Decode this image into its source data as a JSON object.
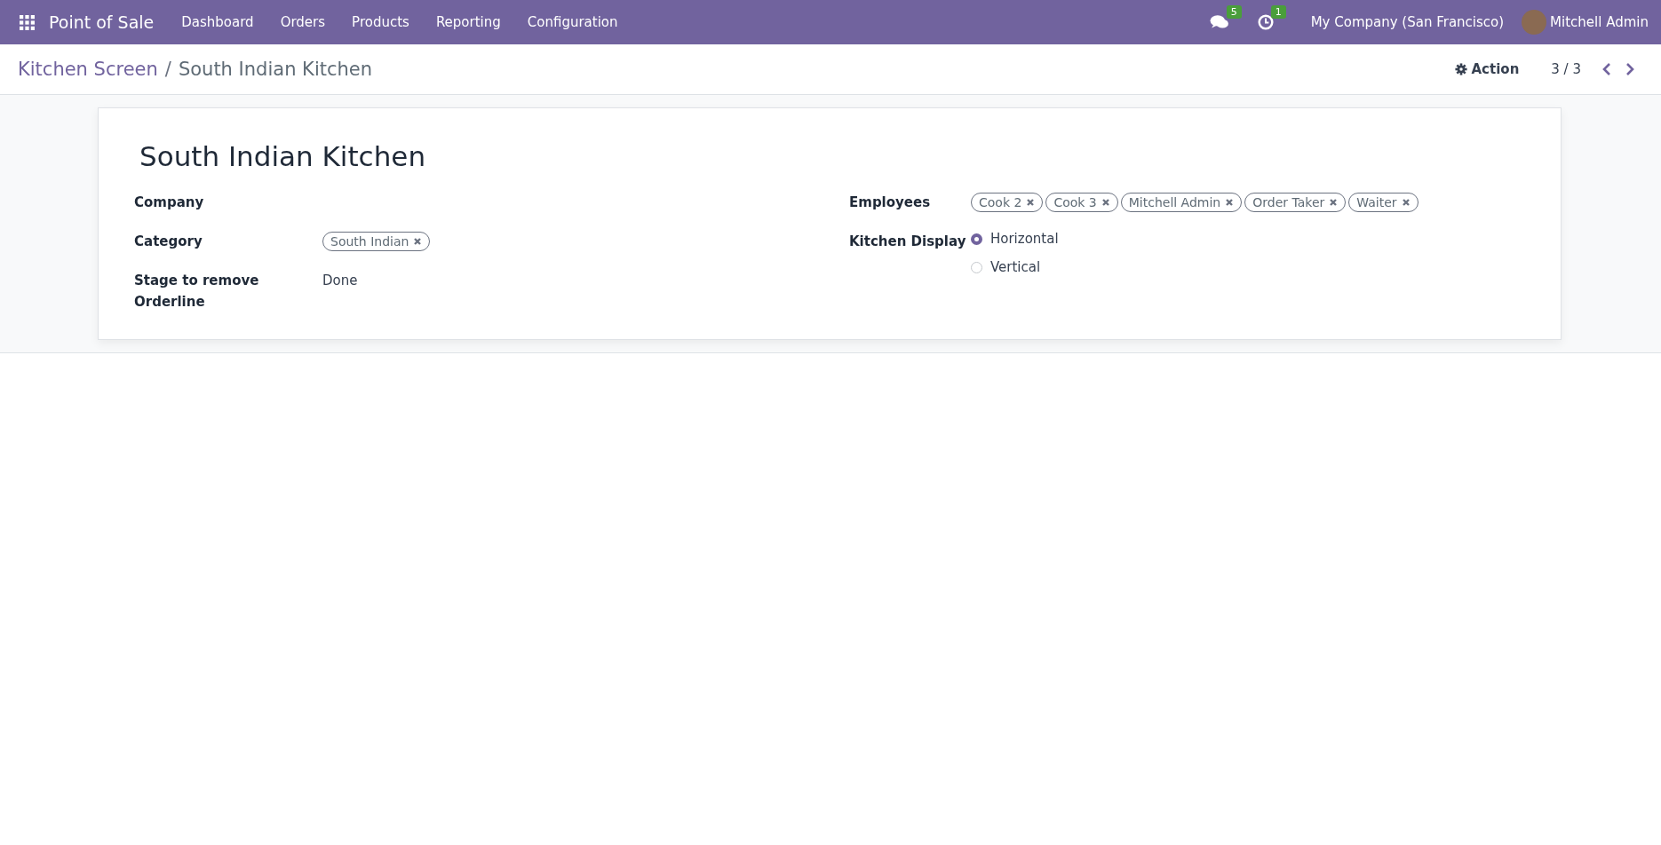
{
  "navbar": {
    "app_name": "Point of Sale",
    "menu": [
      "Dashboard",
      "Orders",
      "Products",
      "Reporting",
      "Configuration"
    ],
    "messages_count": "5",
    "activities_count": "1",
    "company": "My Company (San Francisco)",
    "user": "Mitchell Admin"
  },
  "breadcrumb": {
    "parent": "Kitchen Screen",
    "separator": "/",
    "current": "South Indian Kitchen"
  },
  "control_panel": {
    "action": "Action",
    "pager": "3 / 3"
  },
  "form": {
    "title": "South Indian Kitchen",
    "left_fields": [
      {
        "label": "Company",
        "kind": "empty"
      },
      {
        "label": "Category",
        "kind": "tags",
        "tags": [
          "South Indian"
        ]
      },
      {
        "label": "Stage to remove Orderline",
        "kind": "text",
        "value": "Done"
      }
    ],
    "employees_label": "Employees",
    "employees": [
      "Cook 2",
      "Cook 3",
      "Mitchell Admin",
      "Order Taker",
      "Waiter"
    ],
    "display_label": "Kitchen Display",
    "display_options": [
      {
        "label": "Horizontal",
        "selected": true
      },
      {
        "label": "Vertical",
        "selected": false
      }
    ]
  }
}
